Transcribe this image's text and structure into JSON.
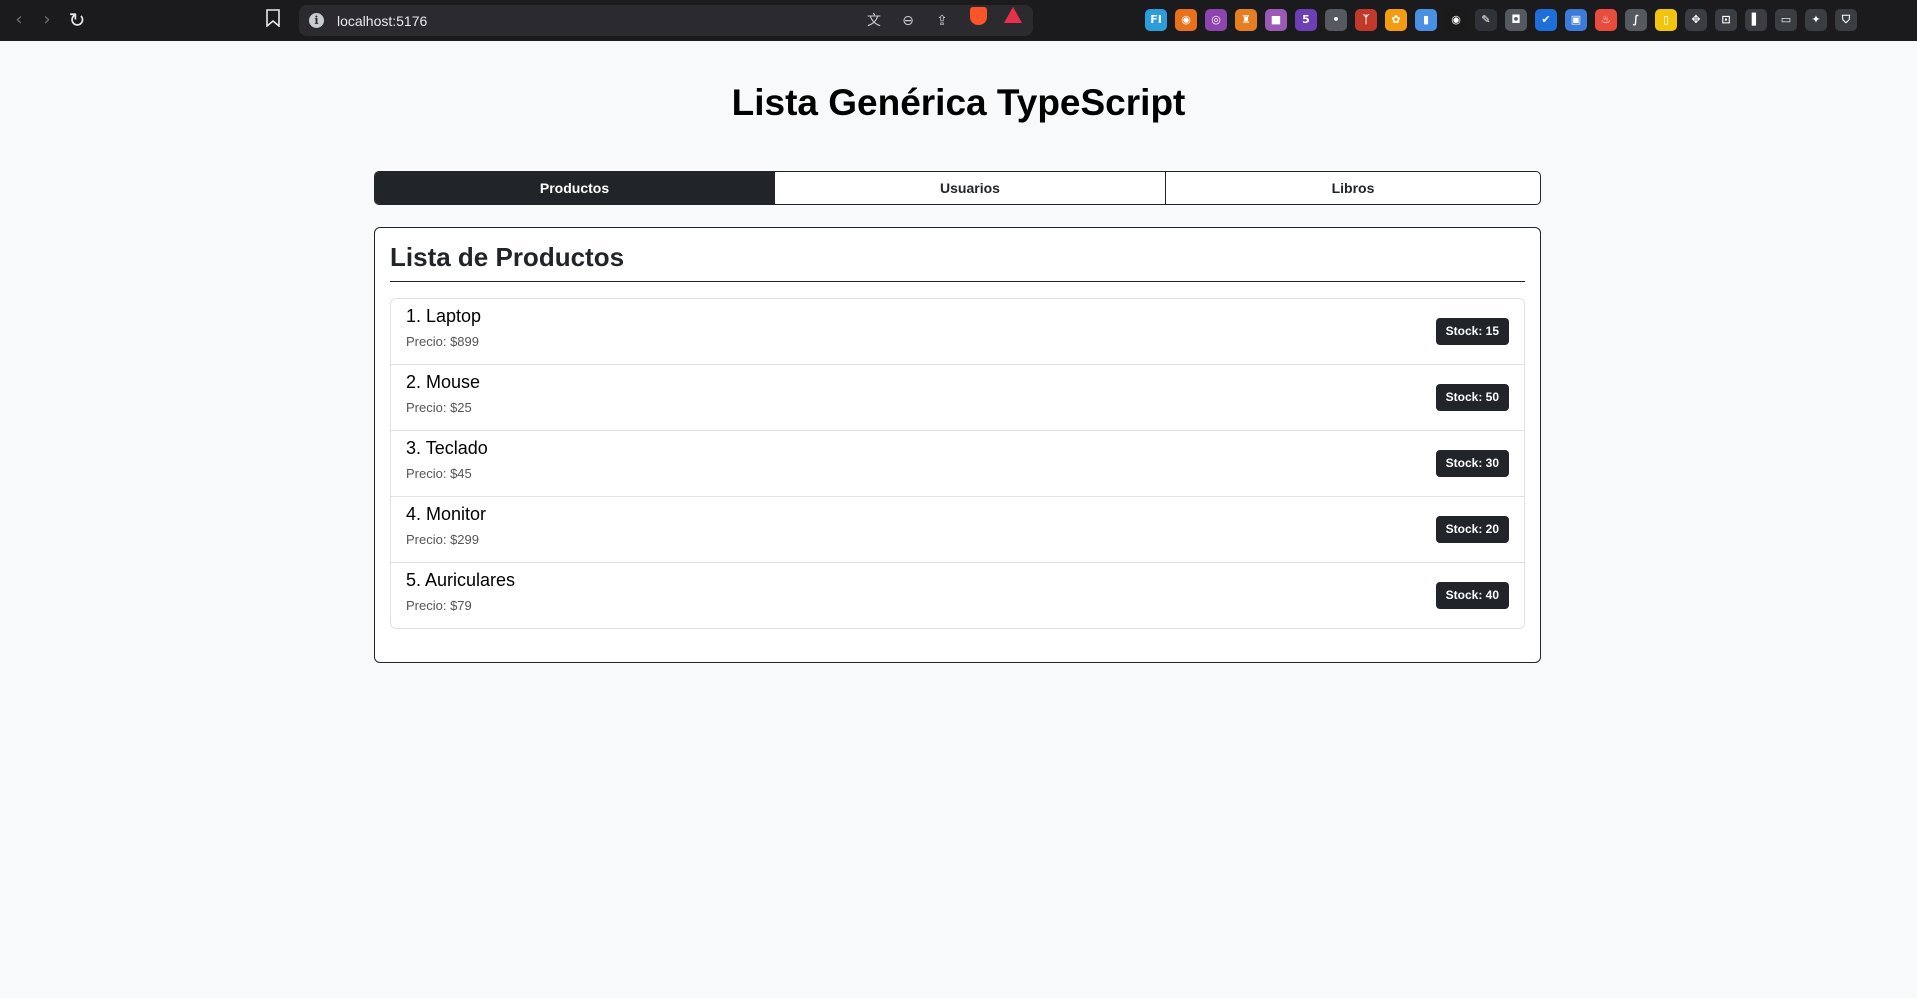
{
  "browser": {
    "url": "localhost:5176",
    "extensions": [
      {
        "icon": "fi-extension-icon",
        "glyph": "FI",
        "color": "#2d9cdb"
      },
      {
        "icon": "orange-circle-extension-icon",
        "glyph": "◉",
        "color": "#e8721c"
      },
      {
        "icon": "purple-circle-extension-icon",
        "glyph": "◎",
        "color": "#8e44ad"
      },
      {
        "icon": "chess-extension-icon",
        "glyph": "♜",
        "color": "#e67e22"
      },
      {
        "icon": "chat-extension-icon",
        "glyph": "■",
        "color": "#9b59b6"
      },
      {
        "icon": "badge-extension-icon",
        "glyph": "5",
        "color": "#6c3fb5"
      },
      {
        "icon": "dot-extension-icon",
        "glyph": "•",
        "color": "#555a60"
      },
      {
        "icon": "tree-extension-icon",
        "glyph": "ᛉ",
        "color": "#c0392b"
      },
      {
        "icon": "gear-extension-icon",
        "glyph": "✿",
        "color": "#f39c12"
      },
      {
        "icon": "doc-extension-icon",
        "glyph": "▮",
        "color": "#4a90e2"
      },
      {
        "icon": "eye-extension-icon",
        "glyph": "◉",
        "color": "#1a1a1a"
      },
      {
        "icon": "tool-extension-icon",
        "glyph": "✎",
        "color": "#2f3338"
      },
      {
        "icon": "camera-extension-icon",
        "glyph": "◘",
        "color": "#555a60"
      },
      {
        "icon": "check-extension-icon",
        "glyph": "✔",
        "color": "#1e6fd9"
      },
      {
        "icon": "window-extension-icon",
        "glyph": "▣",
        "color": "#3d7bd9"
      },
      {
        "icon": "fire-extension-icon",
        "glyph": "♨",
        "color": "#e74c3c"
      },
      {
        "icon": "pen-extension-icon",
        "glyph": "∫",
        "color": "#555a60"
      },
      {
        "icon": "note-extension-icon",
        "glyph": "▯",
        "color": "#f1c40f"
      },
      {
        "icon": "puzzle-extension-icon",
        "glyph": "✥",
        "color": "#3a3d42"
      },
      {
        "icon": "screenshot-extension-icon",
        "glyph": "⊡",
        "color": "#3a3d42"
      },
      {
        "icon": "sidebar-icon",
        "glyph": "▌",
        "color": "#3a3d42"
      },
      {
        "icon": "wallet-icon",
        "glyph": "▭",
        "color": "#3a3d42"
      },
      {
        "icon": "leo-ai-icon",
        "glyph": "✦",
        "color": "#3a3d42"
      },
      {
        "icon": "vpn-shield-icon",
        "glyph": "⛉",
        "color": "#3a3d42"
      }
    ]
  },
  "page": {
    "title": "Lista Genérica TypeScript"
  },
  "tabs": [
    {
      "label": "Productos",
      "active": true
    },
    {
      "label": "Usuarios",
      "active": false
    },
    {
      "label": "Libros",
      "active": false
    }
  ],
  "list": {
    "title": "Lista de Productos",
    "items": [
      {
        "name": "1. Laptop",
        "price": "Precio: $899",
        "stock": "Stock: 15"
      },
      {
        "name": "2. Mouse",
        "price": "Precio: $25",
        "stock": "Stock: 50"
      },
      {
        "name": "3. Teclado",
        "price": "Precio: $45",
        "stock": "Stock: 30"
      },
      {
        "name": "4. Monitor",
        "price": "Precio: $299",
        "stock": "Stock: 20"
      },
      {
        "name": "5. Auriculares",
        "price": "Precio: $79",
        "stock": "Stock: 40"
      }
    ]
  }
}
